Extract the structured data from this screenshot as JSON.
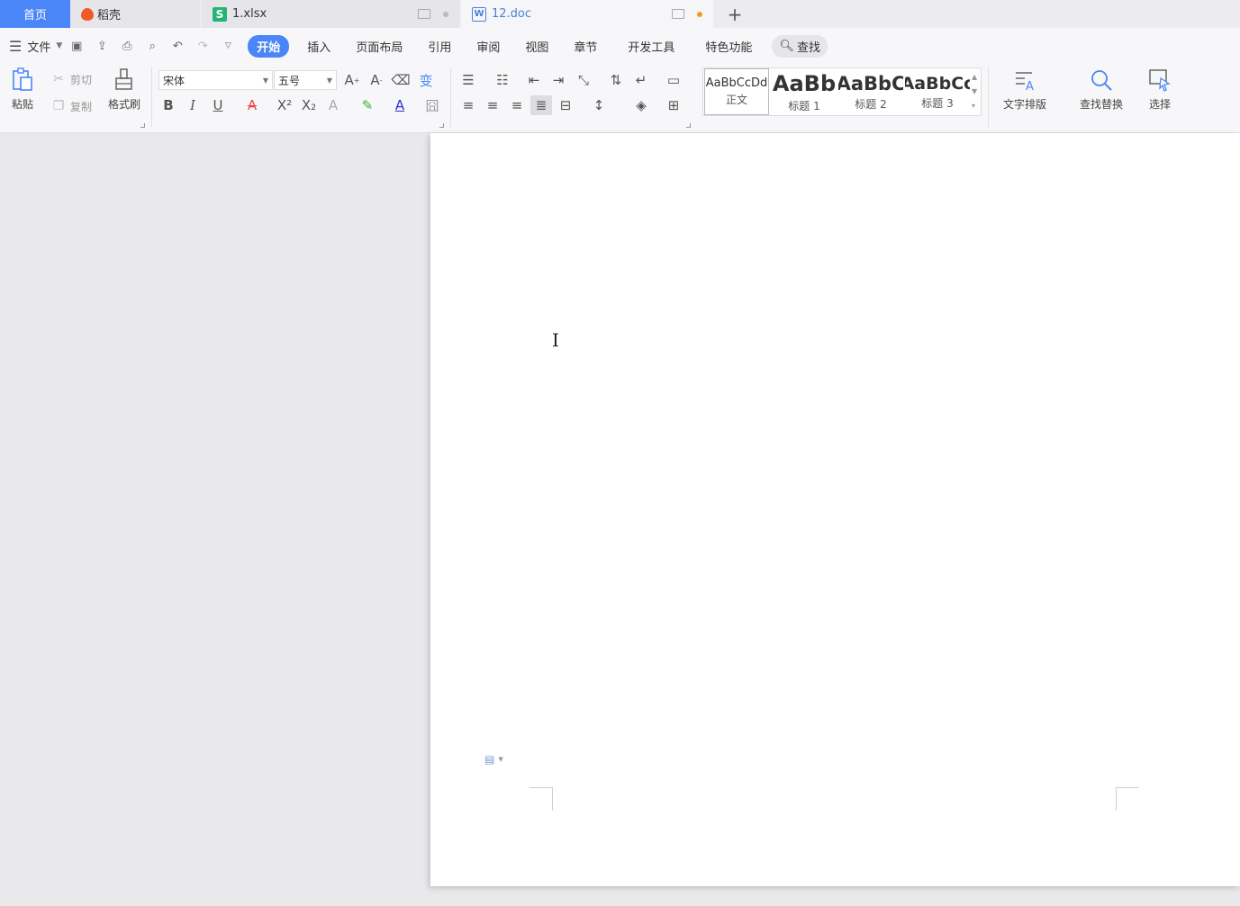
{
  "tabs": {
    "home": "首页",
    "daoke": "稻壳",
    "xlsx": "1.xlsx",
    "doc": "12.doc",
    "new_tab": "+"
  },
  "menu": {
    "file": "文件",
    "items": [
      "开始",
      "插入",
      "页面布局",
      "引用",
      "审阅",
      "视图",
      "章节",
      "开发工具",
      "特色功能"
    ],
    "search": "查找"
  },
  "ribbon": {
    "paste": "粘贴",
    "cut": "剪切",
    "copy": "复制",
    "format_painter": "格式刷",
    "font_name": "宋体",
    "font_size": "五号",
    "text_layout": "文字排版",
    "find_replace": "查找替换",
    "select": "选择",
    "styles": [
      {
        "sample": "AaBbCcDd",
        "caption": "正文"
      },
      {
        "sample": "AaBb",
        "caption": "标题 1"
      },
      {
        "sample": "AaBbC",
        "caption": "标题 2"
      },
      {
        "sample": "AaBbCc",
        "caption": "标题 3"
      }
    ]
  },
  "colors": {
    "accent": "#4a86f7",
    "font_color": "#2b2bd9",
    "highlight": "#34b334",
    "font_effect": "#e84848",
    "doc_tab_text": "#4a7fd8",
    "xlsx_icon": "#22b573",
    "daoke_icon": "#f05a28"
  }
}
